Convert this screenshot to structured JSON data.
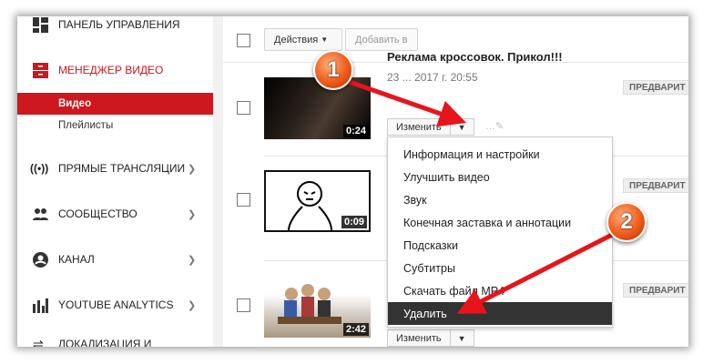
{
  "sidebar": {
    "dashboard": "ПАНЕЛЬ УПРАВЛЕНИЯ",
    "video_manager": "МЕНЕДЖЕР ВИДЕО",
    "videos": "Видео",
    "playlists": "Плейлисты",
    "live": "ПРЯМЫЕ ТРАНСЛЯЦИИ",
    "community": "СООБЩЕСТВО",
    "channel": "КАНАЛ",
    "analytics": "YOUTUBE ANALYTICS",
    "localization": "ЛОКАЛИЗАЦИЯ И"
  },
  "toolbar": {
    "actions": "Действия",
    "add_to": "Добавить в"
  },
  "videos": [
    {
      "title": "Реклама кроссовок. Прикол!!!",
      "date": "23 ... 2017 г. 20:55",
      "duration": "0:24",
      "badge": "ПРЕДВАРИТ",
      "edit": "Изменить"
    },
    {
      "duration": "0:09",
      "badge": "ПРЕДВАРИТ"
    },
    {
      "duration": "2:42",
      "badge": "ПРЕДВАРИТ",
      "edit": "Изменить"
    }
  ],
  "menu": [
    "Информация и настройки",
    "Улучшить видео",
    "Звук",
    "Конечная заставка и аннотации",
    "Подсказки",
    "Субтитры",
    "Скачать файл MP4",
    "Удалить"
  ],
  "callouts": [
    "1",
    "2"
  ],
  "colors": {
    "accent": "#cc181e",
    "arrow": "#e8141c"
  }
}
